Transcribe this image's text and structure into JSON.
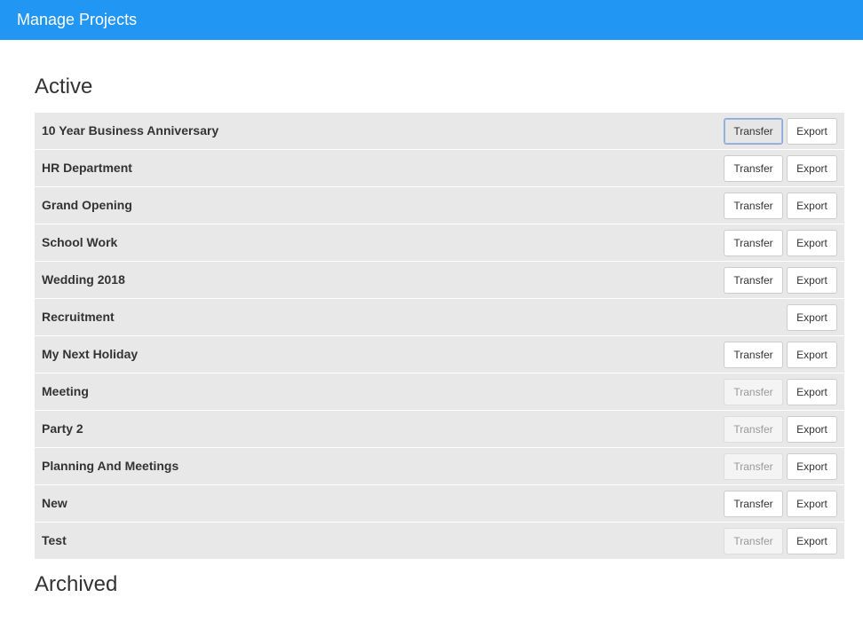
{
  "header": {
    "title": "Manage Projects",
    "bg_color": "#2196f3"
  },
  "sections": {
    "active_heading": "Active",
    "archived_heading": "Archived"
  },
  "projects": [
    {
      "name": "10 Year Business Anniversary",
      "transfer_label": "Transfer",
      "export_label": "Export",
      "transfer_state": "focused"
    },
    {
      "name": "HR Department",
      "transfer_label": "Transfer",
      "export_label": "Export",
      "transfer_state": "enabled"
    },
    {
      "name": "Grand Opening",
      "transfer_label": "Transfer",
      "export_label": "Export",
      "transfer_state": "enabled"
    },
    {
      "name": "School Work",
      "transfer_label": "Transfer",
      "export_label": "Export",
      "transfer_state": "enabled"
    },
    {
      "name": "Wedding 2018",
      "transfer_label": "Transfer",
      "export_label": "Export",
      "transfer_state": "enabled"
    },
    {
      "name": "Recruitment",
      "transfer_label": null,
      "export_label": "Export",
      "transfer_state": "hidden"
    },
    {
      "name": "My Next Holiday",
      "transfer_label": "Transfer",
      "export_label": "Export",
      "transfer_state": "enabled"
    },
    {
      "name": "Meeting",
      "transfer_label": "Transfer",
      "export_label": "Export",
      "transfer_state": "disabled"
    },
    {
      "name": "Party 2",
      "transfer_label": "Transfer",
      "export_label": "Export",
      "transfer_state": "disabled"
    },
    {
      "name": "Planning And Meetings",
      "transfer_label": "Transfer",
      "export_label": "Export",
      "transfer_state": "disabled"
    },
    {
      "name": "New",
      "transfer_label": "Transfer",
      "export_label": "Export",
      "transfer_state": "enabled"
    },
    {
      "name": "Test",
      "transfer_label": "Transfer",
      "export_label": "Export",
      "transfer_state": "disabled"
    }
  ]
}
